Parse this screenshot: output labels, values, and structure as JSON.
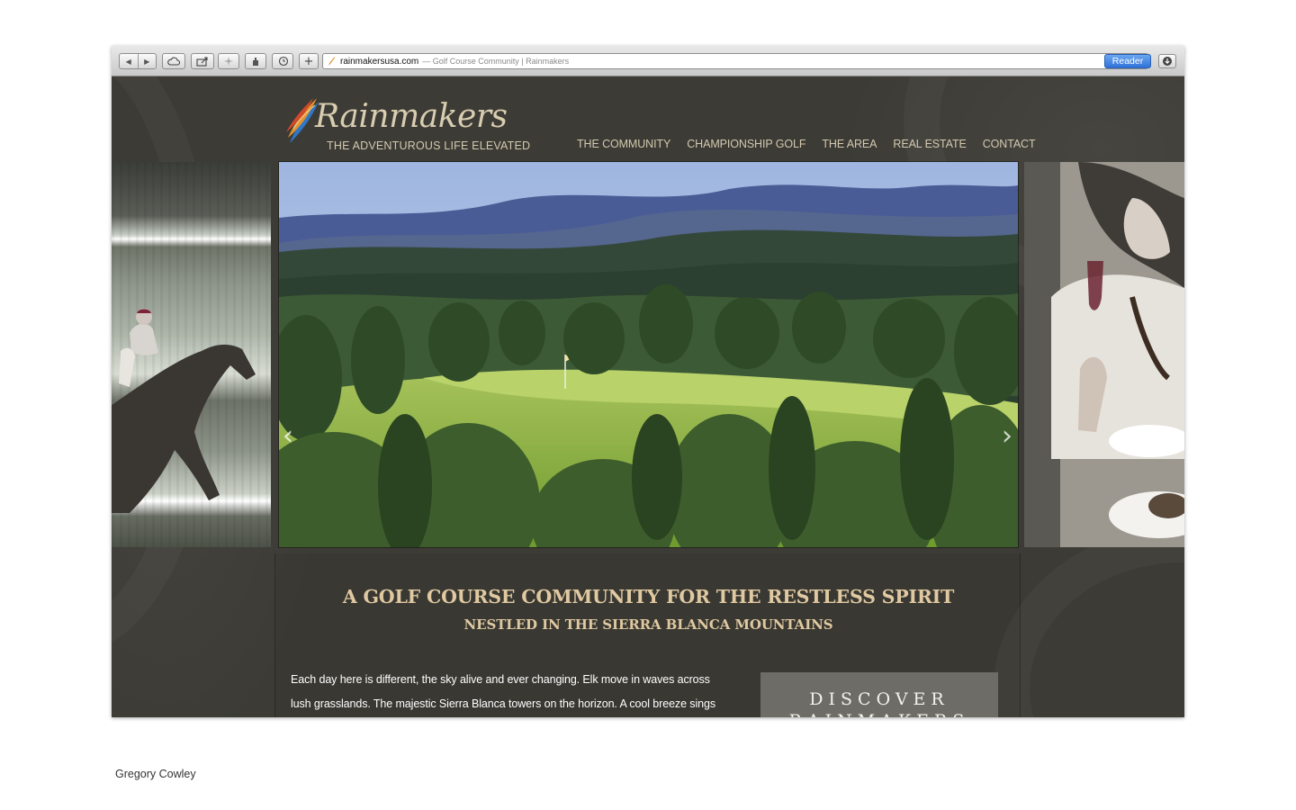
{
  "browser": {
    "url_domain": "rainmakersusa.com",
    "url_title": "— Golf Course Community | Rainmakers",
    "reader_label": "Reader",
    "back_icon": "◀",
    "forward_icon": "▶",
    "add_icon": "+",
    "reload_icon": "↻"
  },
  "site": {
    "logo_text": "Rainmakers",
    "tagline": "THE ADVENTUROUS LIFE ELEVATED",
    "nav": [
      "THE COMMUNITY",
      "CHAMPIONSHIP GOLF",
      "THE AREA",
      "REAL ESTATE",
      "CONTACT"
    ]
  },
  "slider": {
    "prev_icon": "‹",
    "next_icon": "›"
  },
  "content": {
    "headline": "A GOLF COURSE COMMUNITY FOR THE RESTLESS SPIRIT",
    "subheadline": "NESTLED IN THE SIERRA BLANCA MOUNTAINS",
    "body_line1": "Each day here is different, the sky alive and ever changing. Elk move in waves across",
    "body_line2": "lush grasslands. The majestic Sierra Blanca towers on the horizon. A cool breeze sings",
    "discover_line1": "DISCOVER",
    "discover_line2": "RAINMAKERS"
  },
  "credit": "Gregory Cowley"
}
